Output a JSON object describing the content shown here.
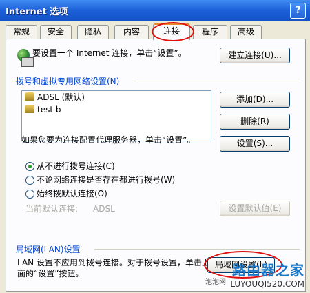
{
  "window": {
    "title": "Internet 选项",
    "help_label": "?"
  },
  "tabs": [
    {
      "label": "常规"
    },
    {
      "label": "安全"
    },
    {
      "label": "隐私"
    },
    {
      "label": "内容"
    },
    {
      "label": "连接"
    },
    {
      "label": "程序"
    },
    {
      "label": "高级"
    }
  ],
  "intro": {
    "text": "要设置一个 Internet 连接，单击“设置”。",
    "setup_button": "建立连接(U)..."
  },
  "dialup": {
    "group_title": "拨号和虚拟专用网络设置(N)",
    "items": [
      {
        "label": "ADSL (默认)"
      },
      {
        "label": "test b"
      }
    ],
    "add_button": "添加(D)...",
    "remove_button": "删除(R)",
    "settings_button": "设置(S)...",
    "proxy_text": "如果您要为连接配置代理服务器，单击“设置”。",
    "options": [
      {
        "label": "从不进行拨号连接(C)",
        "checked": true
      },
      {
        "label": "不论网络连接是否存在都进行拨号(W)",
        "checked": false
      },
      {
        "label": "始终拨默认连接(O)",
        "checked": false
      }
    ],
    "current_default_label": "当前默认连接:",
    "current_default_value": "ADSL",
    "set_default_button": "设置默认值(E)"
  },
  "lan": {
    "group_title": "局域网(LAN)设置",
    "text": "LAN 设置不应用到拨号连接。对于拨号设置，单击上面的“设置”按钮。",
    "lan_button": "局域网设置(L)"
  },
  "watermark": {
    "big": "路由器之家",
    "small": "LUYOUQI520.COM",
    "corner": "泡泡网"
  },
  "colors": {
    "accent": "#0046d5",
    "highlight_circle": "#e01010"
  }
}
